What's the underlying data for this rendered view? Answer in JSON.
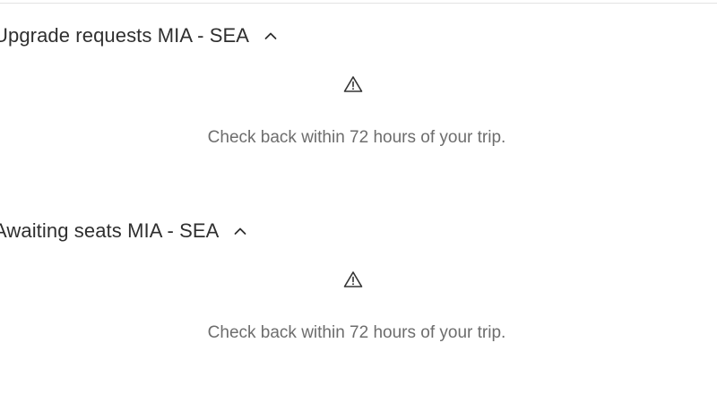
{
  "sections": [
    {
      "title": "Upgrade requests MIA - SEA",
      "expanded": true,
      "chevron_icon": "chevron-up-icon",
      "status_icon": "warning-icon",
      "message": "Check back within 72 hours of your trip."
    },
    {
      "title": "Awaiting seats MIA - SEA",
      "expanded": true,
      "chevron_icon": "chevron-up-icon",
      "status_icon": "warning-icon",
      "message": "Check back within 72 hours of your trip."
    }
  ],
  "colors": {
    "title_text": "#2f2f2f",
    "message_text": "#6d6d6d",
    "divider": "#e3e3e3",
    "background": "#ffffff"
  }
}
